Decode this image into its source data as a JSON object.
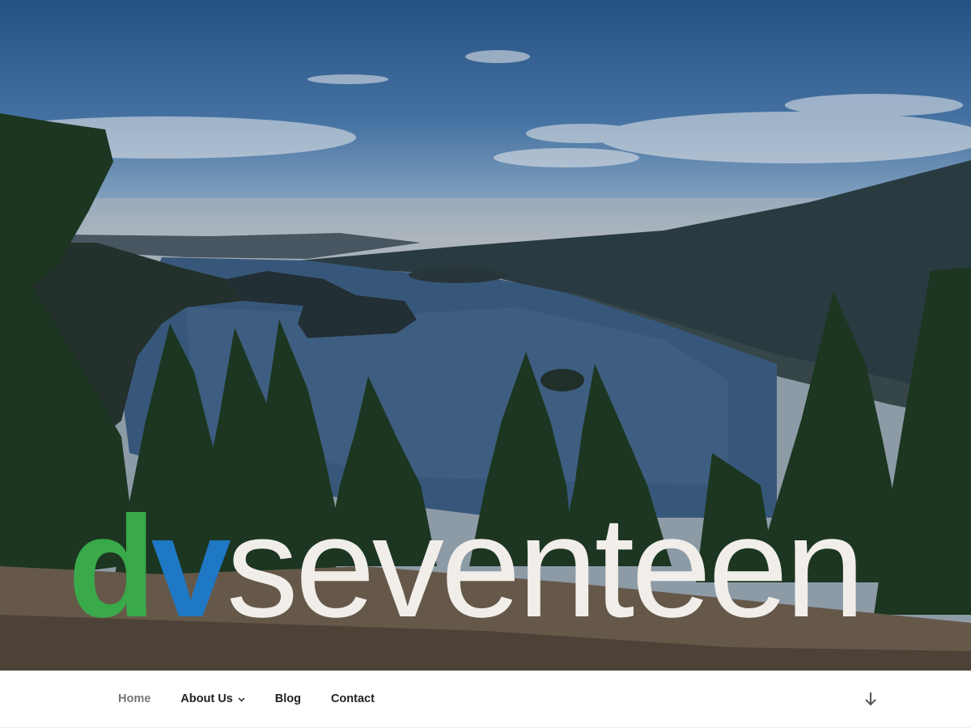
{
  "site": {
    "logo": {
      "part1": "d",
      "part2": "v",
      "part3": "seventeen"
    }
  },
  "nav": {
    "items": [
      {
        "label": "Home",
        "current": true
      },
      {
        "label": "About Us",
        "has_submenu": true
      },
      {
        "label": "Blog"
      },
      {
        "label": "Contact"
      }
    ],
    "scroll_icon": "arrow-down-icon"
  },
  "colors": {
    "logo_d": "#39a94a",
    "logo_v": "#1f78c4",
    "logo_rest": "#f1eeea",
    "nav_current": "#767676",
    "nav_text": "#222222"
  }
}
